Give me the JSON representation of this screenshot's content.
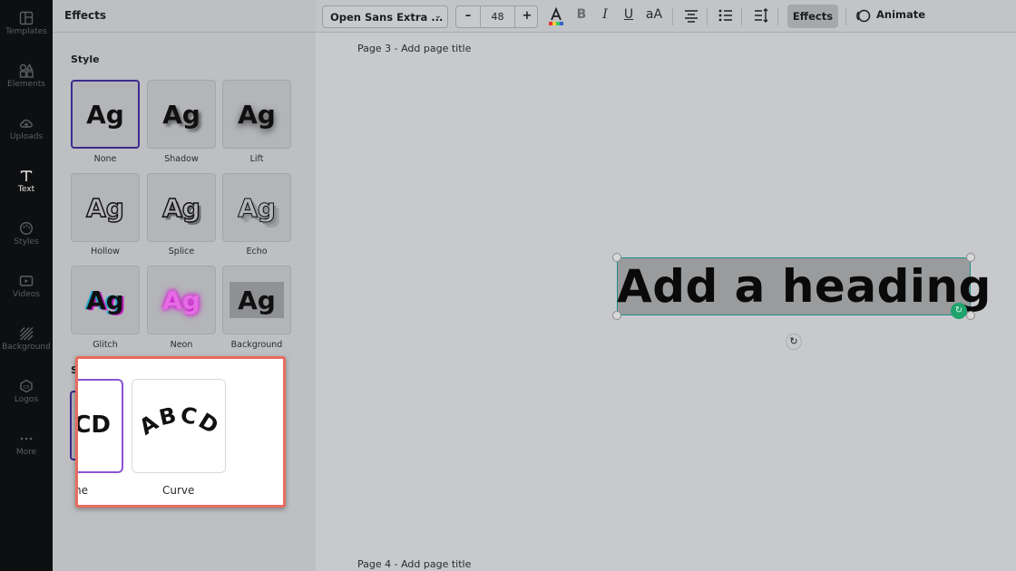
{
  "rail": {
    "items": [
      {
        "label": "Templates",
        "icon": "layout-icon"
      },
      {
        "label": "Elements",
        "icon": "shapes-icon"
      },
      {
        "label": "Uploads",
        "icon": "upload-cloud-icon"
      },
      {
        "label": "Text",
        "icon": "text-icon",
        "active": true
      },
      {
        "label": "Styles",
        "icon": "palette-icon"
      },
      {
        "label": "Videos",
        "icon": "video-icon"
      },
      {
        "label": "Background",
        "icon": "background-icon"
      },
      {
        "label": "Logos",
        "icon": "logo-icon"
      },
      {
        "label": "More",
        "icon": "more-dots-icon"
      }
    ]
  },
  "panel": {
    "title": "Effects",
    "style_label": "Style",
    "shape_label": "S",
    "styles": [
      {
        "sample": "Ag",
        "label": "None"
      },
      {
        "sample": "Ag",
        "label": "Shadow"
      },
      {
        "sample": "Ag",
        "label": "Lift"
      },
      {
        "sample": "Ag",
        "label": "Hollow"
      },
      {
        "sample": "Ag",
        "label": "Splice"
      },
      {
        "sample": "Ag",
        "label": "Echo"
      },
      {
        "sample": "Ag",
        "label": "Glitch"
      },
      {
        "sample": "Ag",
        "label": "Neon"
      },
      {
        "sample": "Ag",
        "label": "Background"
      }
    ]
  },
  "toolbar": {
    "font_name": "Open Sans Extra ...",
    "font_size": "48",
    "minus": "–",
    "plus": "+",
    "bold": "B",
    "italic": "I",
    "underline": "U",
    "case": "aA",
    "effects_label": "Effects",
    "animate_label": "Animate"
  },
  "canvas": {
    "page3_title": "Page 3 - Add page title",
    "page4_title": "Page 4 - Add page title",
    "heading_text": "Add a heading"
  },
  "popup": {
    "none_sample": "CD",
    "none_caption": "ne",
    "curve_sample": "ABCD",
    "curve_caption": "Curve"
  },
  "colors": {
    "rail_bg": "#0e0f10",
    "accent_purple": "#3d2b8e",
    "popup_border": "#e76c5f",
    "selection_teal": "#1d8f8a",
    "neon_pink": "#d21ad2"
  }
}
